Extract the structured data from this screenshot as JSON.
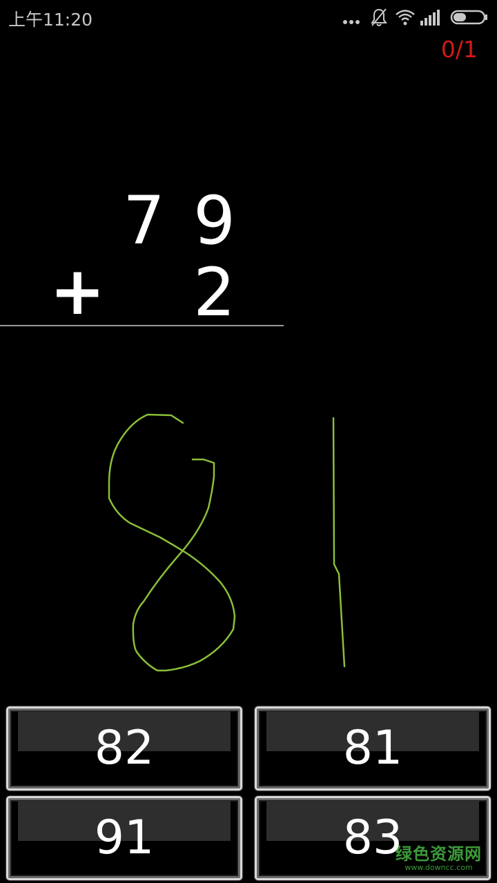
{
  "status_bar": {
    "time": "上午11:20",
    "icons": [
      "more-dots-icon",
      "bell-muted-icon",
      "wifi-icon",
      "signal-icon",
      "battery-icon"
    ]
  },
  "score": "0/1",
  "problem": {
    "top_tens": "7",
    "top_ones": "9",
    "operator": "+",
    "bottom_ones": "2"
  },
  "handwritten_answer": {
    "digits": [
      "8",
      "1"
    ],
    "ink_color": "#8bbf3a"
  },
  "choices": [
    "82",
    "81",
    "91",
    "83"
  ],
  "watermark": {
    "text": "绿色资源网",
    "url": "www.downcc.com"
  },
  "colors": {
    "background": "#000000",
    "score": "#d21a1a",
    "ink": "#8bbf3a",
    "watermark": "#3d9a3a"
  }
}
